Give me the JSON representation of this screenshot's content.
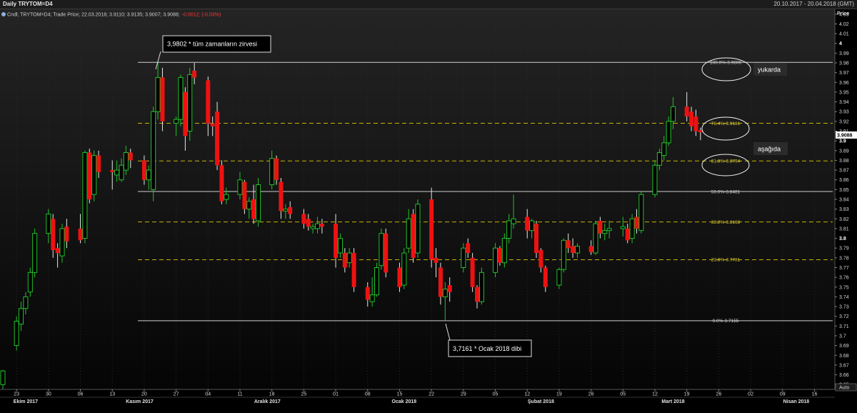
{
  "window": {
    "title": "Daily TRYTOM=D4",
    "date_range": "20.10.2017 - 20.04.2018 (GMT)"
  },
  "legend": {
    "text": "Cndl; TRYTOM=D4; Trade Price; 22.03.2018; 3.9110; 3.9135; 3.9007; 3.9088;",
    "change": "-0.0012; (-0.03%)"
  },
  "axis": {
    "title": "Price",
    "auto_label": "Auto",
    "current_price": "3.9088",
    "y_ticks": [
      "4.03",
      "4.02",
      "4.01",
      "4",
      "3.99",
      "3.98",
      "3.97",
      "3.96",
      "3.95",
      "3.94",
      "3.93",
      "3.92",
      "3.91",
      "3.9",
      "3.89",
      "3.88",
      "3.87",
      "3.86",
      "3.85",
      "3.84",
      "3.83",
      "3.82",
      "3.81",
      "3.8",
      "3.79",
      "3.78",
      "3.77",
      "3.76",
      "3.75",
      "3.74",
      "3.73",
      "3.72",
      "3.71",
      "3.7",
      "3.69",
      "3.68",
      "3.67",
      "3.66",
      "3.65"
    ],
    "y_bold": [
      "4",
      "3.9",
      "3.8"
    ],
    "x_days": [
      {
        "d": "2017-10-23",
        "label": "23"
      },
      {
        "d": "2017-10-30",
        "label": "30"
      },
      {
        "d": "2017-11-06",
        "label": "06"
      },
      {
        "d": "2017-11-13",
        "label": "13"
      },
      {
        "d": "2017-11-20",
        "label": "20"
      },
      {
        "d": "2017-11-27",
        "label": "27"
      },
      {
        "d": "2017-12-04",
        "label": "04"
      },
      {
        "d": "2017-12-11",
        "label": "11"
      },
      {
        "d": "2017-12-18",
        "label": "18"
      },
      {
        "d": "2017-12-25",
        "label": "25"
      },
      {
        "d": "2018-01-01",
        "label": "01"
      },
      {
        "d": "2018-01-08",
        "label": "08"
      },
      {
        "d": "2018-01-15",
        "label": "15"
      },
      {
        "d": "2018-01-22",
        "label": "22"
      },
      {
        "d": "2018-01-29",
        "label": "29"
      },
      {
        "d": "2018-02-05",
        "label": "05"
      },
      {
        "d": "2018-02-12",
        "label": "12"
      },
      {
        "d": "2018-02-19",
        "label": "19"
      },
      {
        "d": "2018-02-26",
        "label": "26"
      },
      {
        "d": "2018-03-05",
        "label": "05"
      },
      {
        "d": "2018-03-12",
        "label": "12"
      },
      {
        "d": "2018-03-19",
        "label": "19"
      },
      {
        "d": "2018-03-26",
        "label": "26"
      },
      {
        "d": "2018-04-02",
        "label": "02"
      },
      {
        "d": "2018-04-09",
        "label": "09"
      },
      {
        "d": "2018-04-16",
        "label": "16"
      }
    ],
    "months": [
      {
        "d": "2017-10-25",
        "label": "Ekim 2017"
      },
      {
        "d": "2017-11-19",
        "label": "Kasım 2017"
      },
      {
        "d": "2017-12-17",
        "label": "Aralık 2017"
      },
      {
        "d": "2018-01-16",
        "label": "Ocak 2018"
      },
      {
        "d": "2018-02-15",
        "label": "Şubat 2018"
      },
      {
        "d": "2018-03-16",
        "label": "Mart 2018"
      },
      {
        "d": "2018-04-12",
        "label": "Nisan 2018"
      }
    ],
    "month_starts": [
      "2017-11-01",
      "2017-12-01",
      "2018-01-01",
      "2018-02-01",
      "2018-03-01",
      "2018-04-01"
    ]
  },
  "annotations": {
    "high_note": "3,9802 * tüm zamanların zirvesi",
    "low_note": "3,7161 * Ocak 2018 dibi",
    "above": "yukarda",
    "below": "aşağıda"
  },
  "colors": {
    "up": "#22c22a",
    "down": "#ee1111",
    "fib_dashed": "#c8b400",
    "fib_solid": "#cfcfcf",
    "current_price_bg": "#ffffff"
  },
  "chart_data": {
    "type": "candlestick",
    "symbol": "TRYTOM=D4",
    "ylim": [
      3.645,
      4.035
    ],
    "xlim": [
      "2017-10-20",
      "2018-04-20"
    ],
    "last": {
      "date": "22.03.2018",
      "open": 3.911,
      "high": 3.9135,
      "low": 3.9007,
      "close": 3.9088,
      "change": -0.0012,
      "change_pct": -0.03
    },
    "fib_levels": [
      {
        "label": "100.0%-3.9806",
        "pct": "100.0%",
        "value": 3.9806,
        "style": "solid"
      },
      {
        "label": "76.4%-3.9181",
        "pct": "76.4%",
        "value": 3.9181,
        "style": "dashed"
      },
      {
        "label": "61.8%-3.8794",
        "pct": "61.8%",
        "value": 3.8794,
        "style": "dashed"
      },
      {
        "label": "50.0%-3.8481",
        "pct": "50.0%",
        "value": 3.8481,
        "style": "solid"
      },
      {
        "label": "38.2%-3.8168",
        "pct": "38.2%",
        "value": 3.8168,
        "style": "dashed"
      },
      {
        "label": "23.6%-3.7781",
        "pct": "23.6%",
        "value": 3.7781,
        "style": "dashed"
      },
      {
        "label": "0.0%-3.7155",
        "pct": "0.0%",
        "value": 3.7155,
        "style": "solid"
      }
    ],
    "candles": [
      {
        "d": "2017-10-20",
        "o": 3.65,
        "h": 3.665,
        "l": 3.645,
        "c": 3.664
      },
      {
        "d": "2017-10-23",
        "o": 3.69,
        "h": 3.72,
        "l": 3.685,
        "c": 3.715
      },
      {
        "d": "2017-10-24",
        "o": 3.712,
        "h": 3.735,
        "l": 3.705,
        "c": 3.728
      },
      {
        "d": "2017-10-25",
        "o": 3.728,
        "h": 3.745,
        "l": 3.722,
        "c": 3.74
      },
      {
        "d": "2017-10-26",
        "o": 3.745,
        "h": 3.77,
        "l": 3.74,
        "c": 3.765
      },
      {
        "d": "2017-10-27",
        "o": 3.765,
        "h": 3.81,
        "l": 3.76,
        "c": 3.805
      },
      {
        "d": "2017-10-30",
        "o": 3.805,
        "h": 3.83,
        "l": 3.795,
        "c": 3.825
      },
      {
        "d": "2017-10-31",
        "o": 3.82,
        "h": 3.825,
        "l": 3.78,
        "c": 3.788
      },
      {
        "d": "2017-11-01",
        "o": 3.79,
        "h": 3.795,
        "l": 3.77,
        "c": 3.785
      },
      {
        "d": "2017-11-02",
        "o": 3.782,
        "h": 3.815,
        "l": 3.775,
        "c": 3.81
      },
      {
        "d": "2017-11-03",
        "o": 3.812,
        "h": 3.82,
        "l": 3.79,
        "c": 3.797
      },
      {
        "d": "2017-11-06",
        "o": 3.81,
        "h": 3.825,
        "l": 3.795,
        "c": 3.798
      },
      {
        "d": "2017-11-07",
        "o": 3.8,
        "h": 3.89,
        "l": 3.795,
        "c": 3.888
      },
      {
        "d": "2017-11-08",
        "o": 3.888,
        "h": 3.892,
        "l": 3.836,
        "c": 3.84
      },
      {
        "d": "2017-11-09",
        "o": 3.845,
        "h": 3.89,
        "l": 3.838,
        "c": 3.885
      },
      {
        "d": "2017-11-10",
        "o": 3.885,
        "h": 3.89,
        "l": 3.862,
        "c": 3.868
      },
      {
        "d": "2017-11-13",
        "o": 3.87,
        "h": 3.88,
        "l": 3.85,
        "c": 3.868
      },
      {
        "d": "2017-11-14",
        "o": 3.865,
        "h": 3.88,
        "l": 3.858,
        "c": 3.87
      },
      {
        "d": "2017-11-15",
        "o": 3.86,
        "h": 3.882,
        "l": 3.858,
        "c": 3.875
      },
      {
        "d": "2017-11-16",
        "o": 3.87,
        "h": 3.895,
        "l": 3.865,
        "c": 3.888
      },
      {
        "d": "2017-11-17",
        "o": 3.888,
        "h": 3.892,
        "l": 3.872,
        "c": 3.88
      },
      {
        "d": "2017-11-20",
        "o": 3.88,
        "h": 3.885,
        "l": 3.855,
        "c": 3.86
      },
      {
        "d": "2017-11-21",
        "o": 3.86,
        "h": 3.875,
        "l": 3.85,
        "c": 3.87
      },
      {
        "d": "2017-11-22",
        "o": 3.85,
        "h": 3.935,
        "l": 3.838,
        "c": 3.93
      },
      {
        "d": "2017-11-23",
        "o": 3.93,
        "h": 3.98,
        "l": 3.922,
        "c": 3.965
      },
      {
        "d": "2017-11-24",
        "o": 3.965,
        "h": 3.975,
        "l": 3.91,
        "c": 3.92
      },
      {
        "d": "2017-11-27",
        "o": 3.918,
        "h": 3.925,
        "l": 3.905,
        "c": 3.922
      },
      {
        "d": "2017-11-28",
        "o": 3.922,
        "h": 3.968,
        "l": 3.915,
        "c": 3.965
      },
      {
        "d": "2017-11-29",
        "o": 3.95,
        "h": 3.955,
        "l": 3.89,
        "c": 3.905
      },
      {
        "d": "2017-11-30",
        "o": 3.91,
        "h": 3.975,
        "l": 3.9,
        "c": 3.968
      },
      {
        "d": "2017-12-01",
        "o": 3.972,
        "h": 3.98,
        "l": 3.958,
        "c": 3.965
      },
      {
        "d": "2017-12-04",
        "o": 3.962,
        "h": 3.966,
        "l": 3.905,
        "c": 3.918
      },
      {
        "d": "2017-12-05",
        "o": 3.918,
        "h": 3.925,
        "l": 3.905,
        "c": 3.915
      },
      {
        "d": "2017-12-06",
        "o": 3.93,
        "h": 3.94,
        "l": 3.87,
        "c": 3.875
      },
      {
        "d": "2017-12-07",
        "o": 3.875,
        "h": 3.88,
        "l": 3.835,
        "c": 3.838
      },
      {
        "d": "2017-12-08",
        "o": 3.84,
        "h": 3.852,
        "l": 3.835,
        "c": 3.845
      },
      {
        "d": "2017-12-11",
        "o": 3.845,
        "h": 3.868,
        "l": 3.84,
        "c": 3.86
      },
      {
        "d": "2017-12-12",
        "o": 3.858,
        "h": 3.86,
        "l": 3.825,
        "c": 3.83
      },
      {
        "d": "2017-12-13",
        "o": 3.83,
        "h": 3.842,
        "l": 3.82,
        "c": 3.838
      },
      {
        "d": "2017-12-14",
        "o": 3.84,
        "h": 3.855,
        "l": 3.815,
        "c": 3.82
      },
      {
        "d": "2017-12-15",
        "o": 3.818,
        "h": 3.862,
        "l": 3.812,
        "c": 3.855
      },
      {
        "d": "2017-12-18",
        "o": 3.855,
        "h": 3.89,
        "l": 3.85,
        "c": 3.882
      },
      {
        "d": "2017-12-19",
        "o": 3.882,
        "h": 3.885,
        "l": 3.855,
        "c": 3.86
      },
      {
        "d": "2017-12-20",
        "o": 3.858,
        "h": 3.862,
        "l": 3.82,
        "c": 3.828
      },
      {
        "d": "2017-12-21",
        "o": 3.828,
        "h": 3.835,
        "l": 3.82,
        "c": 3.83
      },
      {
        "d": "2017-12-22",
        "o": 3.832,
        "h": 3.838,
        "l": 3.82,
        "c": 3.825
      },
      {
        "d": "2017-12-25",
        "o": 3.825,
        "h": 3.83,
        "l": 3.81,
        "c": 3.815
      },
      {
        "d": "2017-12-26",
        "o": 3.82,
        "h": 3.825,
        "l": 3.808,
        "c": 3.812
      },
      {
        "d": "2017-12-27",
        "o": 3.81,
        "h": 3.815,
        "l": 3.805,
        "c": 3.812
      },
      {
        "d": "2017-12-28",
        "o": 3.81,
        "h": 3.822,
        "l": 3.805,
        "c": 3.815
      },
      {
        "d": "2017-12-29",
        "o": 3.815,
        "h": 3.82,
        "l": 3.805,
        "c": 3.812
      },
      {
        "d": "2018-01-01",
        "o": 3.815,
        "h": 3.825,
        "l": 3.77,
        "c": 3.78
      },
      {
        "d": "2018-01-02",
        "o": 3.785,
        "h": 3.805,
        "l": 3.78,
        "c": 3.8
      },
      {
        "d": "2018-01-03",
        "o": 3.785,
        "h": 3.79,
        "l": 3.765,
        "c": 3.77
      },
      {
        "d": "2018-01-04",
        "o": 3.775,
        "h": 3.79,
        "l": 3.77,
        "c": 3.785
      },
      {
        "d": "2018-01-05",
        "o": 3.785,
        "h": 3.79,
        "l": 3.745,
        "c": 3.75
      },
      {
        "d": "2018-01-08",
        "o": 3.75,
        "h": 3.755,
        "l": 3.73,
        "c": 3.737
      },
      {
        "d": "2018-01-09",
        "o": 3.735,
        "h": 3.76,
        "l": 3.73,
        "c": 3.742
      },
      {
        "d": "2018-01-10",
        "o": 3.742,
        "h": 3.775,
        "l": 3.74,
        "c": 3.77
      },
      {
        "d": "2018-01-11",
        "o": 3.772,
        "h": 3.81,
        "l": 3.768,
        "c": 3.805
      },
      {
        "d": "2018-01-12",
        "o": 3.805,
        "h": 3.81,
        "l": 3.76,
        "c": 3.765
      },
      {
        "d": "2018-01-15",
        "o": 3.77,
        "h": 3.775,
        "l": 3.745,
        "c": 3.75
      },
      {
        "d": "2018-01-16",
        "o": 3.752,
        "h": 3.79,
        "l": 3.748,
        "c": 3.785
      },
      {
        "d": "2018-01-17",
        "o": 3.79,
        "h": 3.83,
        "l": 3.785,
        "c": 3.82
      },
      {
        "d": "2018-01-18",
        "o": 3.825,
        "h": 3.83,
        "l": 3.775,
        "c": 3.78
      },
      {
        "d": "2018-01-19",
        "o": 3.785,
        "h": 3.84,
        "l": 3.78,
        "c": 3.835
      },
      {
        "d": "2018-01-22",
        "o": 3.84,
        "h": 3.852,
        "l": 3.77,
        "c": 3.778
      },
      {
        "d": "2018-01-23",
        "o": 3.78,
        "h": 3.79,
        "l": 3.76,
        "c": 3.775
      },
      {
        "d": "2018-01-24",
        "o": 3.77,
        "h": 3.775,
        "l": 3.732,
        "c": 3.74
      },
      {
        "d": "2018-01-25",
        "o": 3.74,
        "h": 3.755,
        "l": 3.716,
        "c": 3.748
      },
      {
        "d": "2018-01-26",
        "o": 3.752,
        "h": 3.76,
        "l": 3.735,
        "c": 3.745
      },
      {
        "d": "2018-01-29",
        "o": 3.77,
        "h": 3.795,
        "l": 3.765,
        "c": 3.79
      },
      {
        "d": "2018-01-30",
        "o": 3.795,
        "h": 3.8,
        "l": 3.78,
        "c": 3.785
      },
      {
        "d": "2018-01-31",
        "o": 3.78,
        "h": 3.785,
        "l": 3.745,
        "c": 3.75
      },
      {
        "d": "2018-02-01",
        "o": 3.75,
        "h": 3.752,
        "l": 3.728,
        "c": 3.735
      },
      {
        "d": "2018-02-02",
        "o": 3.735,
        "h": 3.77,
        "l": 3.732,
        "c": 3.765
      },
      {
        "d": "2018-02-05",
        "o": 3.765,
        "h": 3.795,
        "l": 3.76,
        "c": 3.79
      },
      {
        "d": "2018-02-06",
        "o": 3.79,
        "h": 3.792,
        "l": 3.772,
        "c": 3.775
      },
      {
        "d": "2018-02-07",
        "o": 3.775,
        "h": 3.805,
        "l": 3.77,
        "c": 3.8
      },
      {
        "d": "2018-02-08",
        "o": 3.8,
        "h": 3.825,
        "l": 3.795,
        "c": 3.818
      },
      {
        "d": "2018-02-09",
        "o": 3.815,
        "h": 3.845,
        "l": 3.81,
        "c": 3.82
      },
      {
        "d": "2018-02-12",
        "o": 3.822,
        "h": 3.83,
        "l": 3.8,
        "c": 3.808
      },
      {
        "d": "2018-02-13",
        "o": 3.808,
        "h": 3.82,
        "l": 3.8,
        "c": 3.818
      },
      {
        "d": "2018-02-14",
        "o": 3.815,
        "h": 3.818,
        "l": 3.78,
        "c": 3.785
      },
      {
        "d": "2018-02-15",
        "o": 3.788,
        "h": 3.79,
        "l": 3.765,
        "c": 3.77
      },
      {
        "d": "2018-02-16",
        "o": 3.77,
        "h": 3.772,
        "l": 3.745,
        "c": 3.75
      },
      {
        "d": "2018-02-19",
        "o": 3.752,
        "h": 3.77,
        "l": 3.748,
        "c": 3.768
      },
      {
        "d": "2018-02-20",
        "o": 3.768,
        "h": 3.8,
        "l": 3.765,
        "c": 3.798
      },
      {
        "d": "2018-02-21",
        "o": 3.798,
        "h": 3.805,
        "l": 3.785,
        "c": 3.79
      },
      {
        "d": "2018-02-22",
        "o": 3.792,
        "h": 3.8,
        "l": 3.78,
        "c": 3.785
      },
      {
        "d": "2018-02-23",
        "o": 3.785,
        "h": 3.795,
        "l": 3.78,
        "c": 3.792
      },
      {
        "d": "2018-02-26",
        "o": 3.792,
        "h": 3.798,
        "l": 3.783,
        "c": 3.786
      },
      {
        "d": "2018-02-27",
        "o": 3.785,
        "h": 3.818,
        "l": 3.783,
        "c": 3.815
      },
      {
        "d": "2018-02-28",
        "o": 3.818,
        "h": 3.822,
        "l": 3.8,
        "c": 3.805
      },
      {
        "d": "2018-03-01",
        "o": 3.805,
        "h": 3.815,
        "l": 3.798,
        "c": 3.808
      },
      {
        "d": "2018-03-02",
        "o": 3.808,
        "h": 3.818,
        "l": 3.8,
        "c": 3.81
      },
      {
        "d": "2018-03-05",
        "o": 3.81,
        "h": 3.822,
        "l": 3.802,
        "c": 3.812
      },
      {
        "d": "2018-03-06",
        "o": 3.81,
        "h": 3.815,
        "l": 3.795,
        "c": 3.798
      },
      {
        "d": "2018-03-07",
        "o": 3.8,
        "h": 3.825,
        "l": 3.795,
        "c": 3.82
      },
      {
        "d": "2018-03-08",
        "o": 3.822,
        "h": 3.83,
        "l": 3.805,
        "c": 3.81
      },
      {
        "d": "2018-03-09",
        "o": 3.808,
        "h": 3.848,
        "l": 3.805,
        "c": 3.845
      },
      {
        "d": "2018-03-12",
        "o": 3.845,
        "h": 3.88,
        "l": 3.842,
        "c": 3.875
      },
      {
        "d": "2018-03-13",
        "o": 3.875,
        "h": 3.892,
        "l": 3.87,
        "c": 3.888
      },
      {
        "d": "2018-03-14",
        "o": 3.885,
        "h": 3.905,
        "l": 3.88,
        "c": 3.898
      },
      {
        "d": "2018-03-15",
        "o": 3.898,
        "h": 3.925,
        "l": 3.895,
        "c": 3.92
      },
      {
        "d": "2018-03-16",
        "o": 3.92,
        "h": 3.945,
        "l": 3.912,
        "c": 3.935
      },
      {
        "d": "2018-03-19",
        "o": 3.935,
        "h": 3.95,
        "l": 3.92,
        "c": 3.925
      },
      {
        "d": "2018-03-20",
        "o": 3.93,
        "h": 3.935,
        "l": 3.91,
        "c": 3.915
      },
      {
        "d": "2018-03-21",
        "o": 3.925,
        "h": 3.932,
        "l": 3.905,
        "c": 3.91
      },
      {
        "d": "2018-03-22",
        "o": 3.911,
        "h": 3.9135,
        "l": 3.9007,
        "c": 3.9088
      }
    ]
  }
}
